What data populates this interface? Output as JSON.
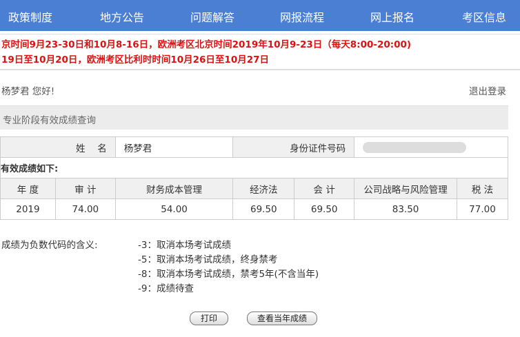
{
  "nav": [
    "政策制度",
    "地方公告",
    "问题解答",
    "网报流程",
    "网上报名",
    "考区信息"
  ],
  "notice": [
    "京时间9月23-30日和10月8-16日，欧洲考区北京时间2019年10月9-23日（每天8:00-20:00)",
    "19日至10月20日，欧洲考区比利时时间10月26日至10月27日"
  ],
  "greeting": "杨梦君 您好!",
  "logout": "退出登录",
  "section_title": "专业阶段有效成绩查询",
  "name_label": "姓　 名",
  "name_value": "杨梦君",
  "id_label": "身份证件号码",
  "valid_label": "有效成绩如下:",
  "headers": [
    "年 度",
    "审 计",
    "财务成本管理",
    "经济法",
    "会 计",
    "公司战略与风险管理",
    "税 法"
  ],
  "row": [
    "2019",
    "74.00",
    "54.00",
    "69.50",
    "69.50",
    "83.50",
    "77.00"
  ],
  "legend_title": "成绩为负数代码的含义:",
  "legend": [
    "-3：取消本场考试成绩",
    "-5：取消本场考试成绩，终身禁考",
    "-8：取消本场考试成绩，禁考5年(不含当年)",
    "-9：成绩待查"
  ],
  "print": "打印",
  "view_year": "查看当年成绩"
}
